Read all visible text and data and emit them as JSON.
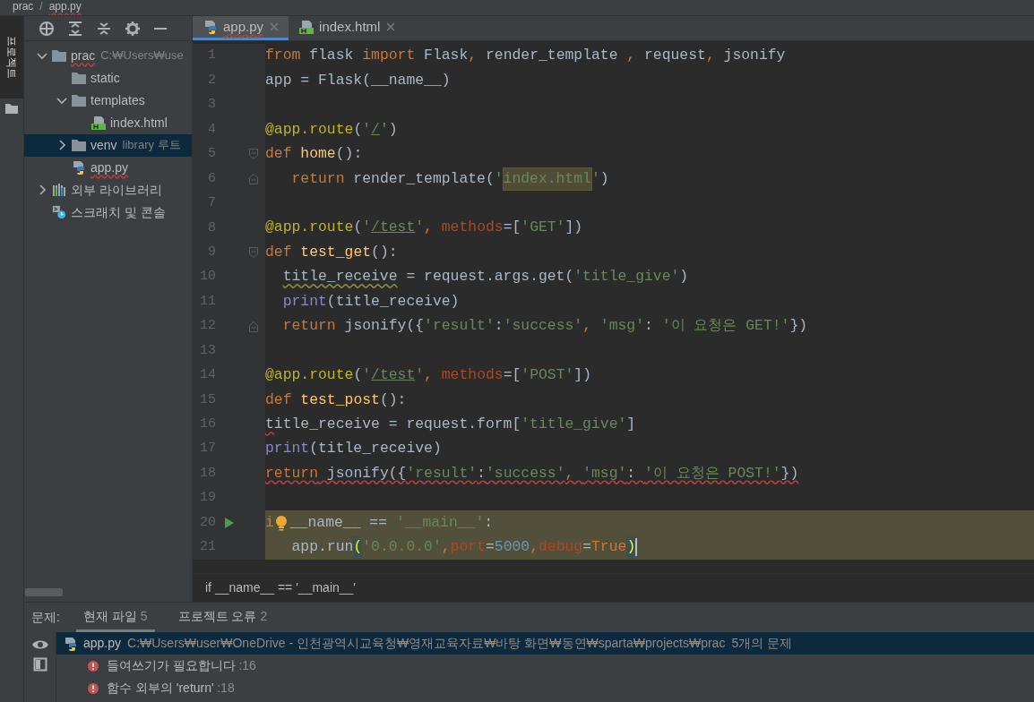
{
  "breadcrumb": {
    "separator": "/",
    "items": [
      {
        "label": "prac",
        "has_errors": false
      },
      {
        "label": "app.py",
        "has_errors": true
      }
    ]
  },
  "side_tabs": [
    {
      "label": "프로젝트",
      "selected": true
    }
  ],
  "tree": [
    {
      "name": "prac",
      "kind": "folder",
      "expanded": true,
      "selected": false,
      "has_errors": true,
      "hint": "C:₩Users₩use",
      "children": [
        {
          "name": "static",
          "kind": "folder",
          "selected": false,
          "has_errors": false
        },
        {
          "name": "templates",
          "kind": "folder",
          "expanded": true,
          "selected": false,
          "has_errors": false,
          "children": [
            {
              "name": "index.html",
              "kind": "html",
              "selected": false,
              "has_errors": false
            }
          ]
        },
        {
          "name": "venv",
          "kind": "folder",
          "expanded": false,
          "selected": true,
          "has_errors": false,
          "hint": "library 루트"
        },
        {
          "name": "app.py",
          "kind": "python",
          "selected": false,
          "has_errors": true
        }
      ]
    },
    {
      "name": "외부 라이브러리",
      "kind": "library",
      "expanded": false,
      "selected": false,
      "has_errors": false
    },
    {
      "name": "스크래치 및 콘솔",
      "kind": "scratch",
      "selected": false,
      "has_errors": false
    }
  ],
  "editor_tabs": [
    {
      "label": "app.py",
      "kind": "python",
      "selected": true,
      "has_errors": true
    },
    {
      "label": "index.html",
      "kind": "html",
      "selected": false,
      "has_errors": false
    }
  ],
  "code_lines": [
    {
      "number": "1",
      "tokens": [
        {
          "kind": "kw",
          "text": "from"
        },
        {
          "kind": "plain",
          "text": " flask "
        },
        {
          "kind": "kw",
          "text": "import"
        },
        {
          "kind": "plain",
          "text": " Flask"
        },
        {
          "kind": "kw",
          "text": ","
        },
        {
          "kind": "plain",
          "text": " render_template "
        },
        {
          "kind": "kw",
          "text": ","
        },
        {
          "kind": "plain",
          "text": " request"
        },
        {
          "kind": "kw",
          "text": ","
        },
        {
          "kind": "plain",
          "text": " jsonify"
        }
      ]
    },
    {
      "number": "2",
      "tokens": [
        {
          "kind": "plain",
          "text": "app = Flask(__name__)"
        }
      ]
    },
    {
      "number": "3"
    },
    {
      "number": "4",
      "tokens": [
        {
          "kind": "deco",
          "text": "@app.route"
        },
        {
          "kind": "plain",
          "text": "("
        },
        {
          "kind": "str",
          "text": "'"
        },
        {
          "kind": "link",
          "text": "/"
        },
        {
          "kind": "str",
          "text": "'"
        },
        {
          "kind": "plain",
          "text": ")"
        }
      ]
    },
    {
      "number": "5",
      "fold_start": true,
      "tokens": [
        {
          "kind": "kw",
          "text": "def "
        },
        {
          "kind": "fn",
          "text": "home"
        },
        {
          "kind": "plain",
          "text": "():"
        }
      ]
    },
    {
      "number": "6",
      "fold_end": true,
      "tokens": [
        {
          "kind": "kw",
          "text": "   return"
        },
        {
          "kind": "plain",
          "text": " render_template("
        },
        {
          "kind": "str",
          "text": "'"
        },
        {
          "kind": "strhl",
          "text": "index.html"
        },
        {
          "kind": "str",
          "text": "'"
        },
        {
          "kind": "plain",
          "text": ")"
        }
      ]
    },
    {
      "number": "7"
    },
    {
      "number": "8",
      "tokens": [
        {
          "kind": "deco",
          "text": "@app.route"
        },
        {
          "kind": "plain",
          "text": "("
        },
        {
          "kind": "str",
          "text": "'"
        },
        {
          "kind": "link",
          "text": "/test"
        },
        {
          "kind": "str",
          "text": "'"
        },
        {
          "kind": "kw",
          "text": ", "
        },
        {
          "kind": "param",
          "text": "methods"
        },
        {
          "kind": "plain",
          "text": "=["
        },
        {
          "kind": "str",
          "text": "'GET'"
        },
        {
          "kind": "plain",
          "text": "])"
        }
      ]
    },
    {
      "number": "9",
      "fold_start": true,
      "tokens": [
        {
          "kind": "kw",
          "text": "def "
        },
        {
          "kind": "fn",
          "text": "test_get"
        },
        {
          "kind": "plain",
          "text": "():"
        }
      ]
    },
    {
      "number": "10",
      "indented": true,
      "tokens": [
        {
          "kind": "plain",
          "text": "title_receive",
          "warning_squiggle": true
        },
        {
          "kind": "plain",
          "text": " = request.args.get("
        },
        {
          "kind": "str",
          "text": "'title_give'"
        },
        {
          "kind": "plain",
          "text": ")"
        }
      ]
    },
    {
      "number": "11",
      "tokens": [
        {
          "kind": "builtin",
          "text": "  print"
        },
        {
          "kind": "plain",
          "text": "(title_receive)"
        }
      ]
    },
    {
      "number": "12",
      "fold_end": true,
      "tokens": [
        {
          "kind": "kw",
          "text": "  return"
        },
        {
          "kind": "plain",
          "text": " jsonify({"
        },
        {
          "kind": "str",
          "text": "'result'"
        },
        {
          "kind": "plain",
          "text": ":"
        },
        {
          "kind": "str",
          "text": "'success'"
        },
        {
          "kind": "kw",
          "text": ", "
        },
        {
          "kind": "str",
          "text": "'msg'"
        },
        {
          "kind": "plain",
          "text": ": "
        },
        {
          "kind": "str",
          "text": "'이 요청은 GET!'"
        },
        {
          "kind": "plain",
          "text": "})"
        }
      ]
    },
    {
      "number": "13"
    },
    {
      "number": "14",
      "tokens": [
        {
          "kind": "deco",
          "text": "@app.route"
        },
        {
          "kind": "plain",
          "text": "("
        },
        {
          "kind": "str",
          "text": "'"
        },
        {
          "kind": "link",
          "text": "/test"
        },
        {
          "kind": "str",
          "text": "'"
        },
        {
          "kind": "kw",
          "text": ", "
        },
        {
          "kind": "param",
          "text": "methods"
        },
        {
          "kind": "plain",
          "text": "=["
        },
        {
          "kind": "str",
          "text": "'POST'"
        },
        {
          "kind": "plain",
          "text": "])"
        }
      ]
    },
    {
      "number": "15",
      "tokens": [
        {
          "kind": "kw",
          "text": "def "
        },
        {
          "kind": "fn",
          "text": "test_post"
        },
        {
          "kind": "plain",
          "text": "():"
        }
      ]
    },
    {
      "number": "16",
      "tokens": [
        {
          "kind": "plain",
          "text": "t",
          "error_squiggle": true
        },
        {
          "kind": "plain",
          "text": "itle_receive = request.form["
        },
        {
          "kind": "str",
          "text": "'title_give'"
        },
        {
          "kind": "plain",
          "text": "]"
        }
      ]
    },
    {
      "number": "17",
      "tokens": [
        {
          "kind": "builtin",
          "text": "print"
        },
        {
          "kind": "plain",
          "text": "(title_receive)"
        }
      ]
    },
    {
      "number": "18",
      "tokens": [
        {
          "kind": "kw",
          "text": "return",
          "error_squiggle": true
        },
        {
          "kind": "plain",
          "text": " jsonify({",
          "error_squiggle": true
        },
        {
          "kind": "str",
          "text": "'result'",
          "error_squiggle": true
        },
        {
          "kind": "plain",
          "text": ":",
          "error_squiggle": true
        },
        {
          "kind": "str",
          "text": "'success'",
          "error_squiggle": true
        },
        {
          "kind": "kw",
          "text": ", ",
          "error_squiggle": true
        },
        {
          "kind": "str",
          "text": "'msg'",
          "error_squiggle": true
        },
        {
          "kind": "plain",
          "text": ": ",
          "error_squiggle": true
        },
        {
          "kind": "str",
          "text": "'이 요청은 POST!'",
          "error_squiggle": true
        },
        {
          "kind": "plain",
          "text": "})",
          "error_squiggle": true
        }
      ]
    },
    {
      "number": "19"
    },
    {
      "number": "20",
      "run": true,
      "highlighted": true,
      "tokens": [
        {
          "kind": "kw",
          "text": "i"
        },
        {
          "kind": "bulb"
        },
        {
          "kind": "plain",
          "text": "__name__ == "
        },
        {
          "kind": "str",
          "text": "'__main__'"
        },
        {
          "kind": "plain",
          "text": ":"
        }
      ]
    },
    {
      "number": "21",
      "highlighted": true,
      "caret": true,
      "tokens": [
        {
          "kind": "plain",
          "text": "   app.run"
        },
        {
          "kind": "brace",
          "text": "("
        },
        {
          "kind": "str",
          "text": "'0.0.0.0'"
        },
        {
          "kind": "kw",
          "text": ","
        },
        {
          "kind": "param",
          "text": "port"
        },
        {
          "kind": "plain",
          "text": "="
        },
        {
          "kind": "num",
          "text": "5000"
        },
        {
          "kind": "kw",
          "text": ","
        },
        {
          "kind": "param",
          "text": "debug"
        },
        {
          "kind": "plain",
          "text": "="
        },
        {
          "kind": "kw",
          "text": "True"
        },
        {
          "kind": "brace",
          "text": ")"
        }
      ]
    }
  ],
  "editor_breadcrumb": "if __name__ == '__main__'",
  "problems": {
    "label": "문제:",
    "tabs": [
      {
        "label": "현재 파일",
        "count": "5",
        "selected": true
      },
      {
        "label": "프로젝트 오류",
        "count": "2",
        "selected": false
      }
    ],
    "file": {
      "name": "app.py",
      "path": "C:₩Users₩user₩OneDrive - 인천광역시교육청₩영재교육자료₩바탕 화면₩동연₩sparta₩projects₩prac",
      "summary": "5개의 문제",
      "selected": true
    },
    "errors": [
      {
        "message": "들여쓰기가 필요합니다",
        "location": ":16"
      },
      {
        "message": "함수 외부의 'return'",
        "location": ":18"
      }
    ]
  }
}
